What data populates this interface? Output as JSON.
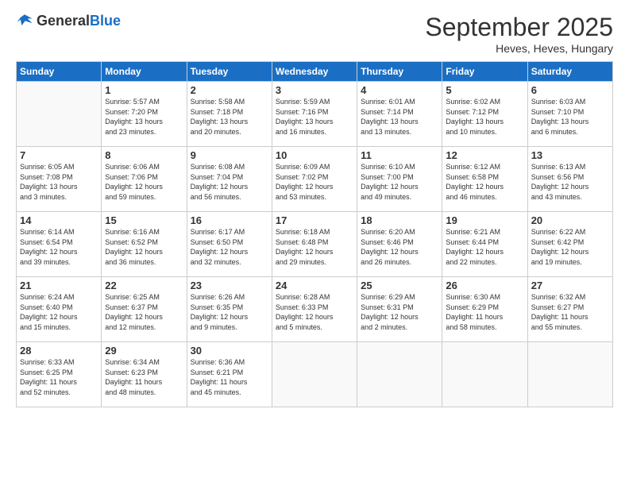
{
  "logo": {
    "general": "General",
    "blue": "Blue"
  },
  "title": "September 2025",
  "subtitle": "Heves, Heves, Hungary",
  "headers": [
    "Sunday",
    "Monday",
    "Tuesday",
    "Wednesday",
    "Thursday",
    "Friday",
    "Saturday"
  ],
  "weeks": [
    [
      {
        "day": "",
        "info": ""
      },
      {
        "day": "1",
        "info": "Sunrise: 5:57 AM\nSunset: 7:20 PM\nDaylight: 13 hours\nand 23 minutes."
      },
      {
        "day": "2",
        "info": "Sunrise: 5:58 AM\nSunset: 7:18 PM\nDaylight: 13 hours\nand 20 minutes."
      },
      {
        "day": "3",
        "info": "Sunrise: 5:59 AM\nSunset: 7:16 PM\nDaylight: 13 hours\nand 16 minutes."
      },
      {
        "day": "4",
        "info": "Sunrise: 6:01 AM\nSunset: 7:14 PM\nDaylight: 13 hours\nand 13 minutes."
      },
      {
        "day": "5",
        "info": "Sunrise: 6:02 AM\nSunset: 7:12 PM\nDaylight: 13 hours\nand 10 minutes."
      },
      {
        "day": "6",
        "info": "Sunrise: 6:03 AM\nSunset: 7:10 PM\nDaylight: 13 hours\nand 6 minutes."
      }
    ],
    [
      {
        "day": "7",
        "info": "Sunrise: 6:05 AM\nSunset: 7:08 PM\nDaylight: 13 hours\nand 3 minutes."
      },
      {
        "day": "8",
        "info": "Sunrise: 6:06 AM\nSunset: 7:06 PM\nDaylight: 12 hours\nand 59 minutes."
      },
      {
        "day": "9",
        "info": "Sunrise: 6:08 AM\nSunset: 7:04 PM\nDaylight: 12 hours\nand 56 minutes."
      },
      {
        "day": "10",
        "info": "Sunrise: 6:09 AM\nSunset: 7:02 PM\nDaylight: 12 hours\nand 53 minutes."
      },
      {
        "day": "11",
        "info": "Sunrise: 6:10 AM\nSunset: 7:00 PM\nDaylight: 12 hours\nand 49 minutes."
      },
      {
        "day": "12",
        "info": "Sunrise: 6:12 AM\nSunset: 6:58 PM\nDaylight: 12 hours\nand 46 minutes."
      },
      {
        "day": "13",
        "info": "Sunrise: 6:13 AM\nSunset: 6:56 PM\nDaylight: 12 hours\nand 43 minutes."
      }
    ],
    [
      {
        "day": "14",
        "info": "Sunrise: 6:14 AM\nSunset: 6:54 PM\nDaylight: 12 hours\nand 39 minutes."
      },
      {
        "day": "15",
        "info": "Sunrise: 6:16 AM\nSunset: 6:52 PM\nDaylight: 12 hours\nand 36 minutes."
      },
      {
        "day": "16",
        "info": "Sunrise: 6:17 AM\nSunset: 6:50 PM\nDaylight: 12 hours\nand 32 minutes."
      },
      {
        "day": "17",
        "info": "Sunrise: 6:18 AM\nSunset: 6:48 PM\nDaylight: 12 hours\nand 29 minutes."
      },
      {
        "day": "18",
        "info": "Sunrise: 6:20 AM\nSunset: 6:46 PM\nDaylight: 12 hours\nand 26 minutes."
      },
      {
        "day": "19",
        "info": "Sunrise: 6:21 AM\nSunset: 6:44 PM\nDaylight: 12 hours\nand 22 minutes."
      },
      {
        "day": "20",
        "info": "Sunrise: 6:22 AM\nSunset: 6:42 PM\nDaylight: 12 hours\nand 19 minutes."
      }
    ],
    [
      {
        "day": "21",
        "info": "Sunrise: 6:24 AM\nSunset: 6:40 PM\nDaylight: 12 hours\nand 15 minutes."
      },
      {
        "day": "22",
        "info": "Sunrise: 6:25 AM\nSunset: 6:37 PM\nDaylight: 12 hours\nand 12 minutes."
      },
      {
        "day": "23",
        "info": "Sunrise: 6:26 AM\nSunset: 6:35 PM\nDaylight: 12 hours\nand 9 minutes."
      },
      {
        "day": "24",
        "info": "Sunrise: 6:28 AM\nSunset: 6:33 PM\nDaylight: 12 hours\nand 5 minutes."
      },
      {
        "day": "25",
        "info": "Sunrise: 6:29 AM\nSunset: 6:31 PM\nDaylight: 12 hours\nand 2 minutes."
      },
      {
        "day": "26",
        "info": "Sunrise: 6:30 AM\nSunset: 6:29 PM\nDaylight: 11 hours\nand 58 minutes."
      },
      {
        "day": "27",
        "info": "Sunrise: 6:32 AM\nSunset: 6:27 PM\nDaylight: 11 hours\nand 55 minutes."
      }
    ],
    [
      {
        "day": "28",
        "info": "Sunrise: 6:33 AM\nSunset: 6:25 PM\nDaylight: 11 hours\nand 52 minutes."
      },
      {
        "day": "29",
        "info": "Sunrise: 6:34 AM\nSunset: 6:23 PM\nDaylight: 11 hours\nand 48 minutes."
      },
      {
        "day": "30",
        "info": "Sunrise: 6:36 AM\nSunset: 6:21 PM\nDaylight: 11 hours\nand 45 minutes."
      },
      {
        "day": "",
        "info": ""
      },
      {
        "day": "",
        "info": ""
      },
      {
        "day": "",
        "info": ""
      },
      {
        "day": "",
        "info": ""
      }
    ]
  ]
}
